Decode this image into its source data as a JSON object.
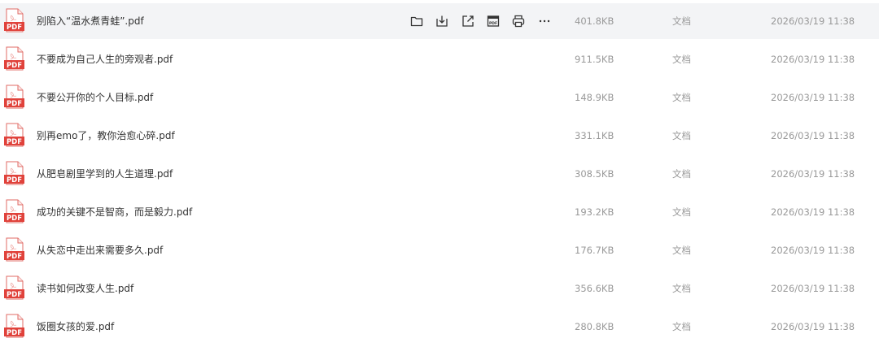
{
  "files": [
    {
      "name": "别陷入“温水煮青蛙”.pdf",
      "size": "401.8KB",
      "type": "文档",
      "date": "2026/03/19 11:38",
      "icon": "pdf-file-icon"
    },
    {
      "name": "不要成为自己人生的旁观者.pdf",
      "size": "911.5KB",
      "type": "文档",
      "date": "2026/03/19 11:38",
      "icon": "pdf-file-icon"
    },
    {
      "name": "不要公开你的个人目标.pdf",
      "size": "148.9KB",
      "type": "文档",
      "date": "2026/03/19 11:38",
      "icon": "pdf-file-icon"
    },
    {
      "name": "别再emo了，教你治愈心碎.pdf",
      "size": "331.1KB",
      "type": "文档",
      "date": "2026/03/19 11:38",
      "icon": "pdf-file-icon"
    },
    {
      "name": "从肥皂剧里学到的人生道理.pdf",
      "size": "308.5KB",
      "type": "文档",
      "date": "2026/03/19 11:38",
      "icon": "pdf-file-icon"
    },
    {
      "name": "成功的关键不是智商，而是毅力.pdf",
      "size": "193.2KB",
      "type": "文档",
      "date": "2026/03/19 11:38",
      "icon": "pdf-file-icon"
    },
    {
      "name": "从失恋中走出来需要多久.pdf",
      "size": "176.7KB",
      "type": "文档",
      "date": "2026/03/19 11:38",
      "icon": "pdf-file-icon"
    },
    {
      "name": "读书如何改变人生.pdf",
      "size": "356.6KB",
      "type": "文档",
      "date": "2026/03/19 11:38",
      "icon": "pdf-file-icon"
    },
    {
      "name": "饭圈女孩的爱.pdf",
      "size": "280.8KB",
      "type": "文档",
      "date": "2026/03/19 11:38",
      "icon": "pdf-file-icon"
    }
  ],
  "pdf_icon_label": "PDF",
  "row_actions": [
    "folder-icon",
    "download-icon",
    "share-icon",
    "convert-pdf-icon",
    "print-icon",
    "more-icon"
  ],
  "colors": {
    "pdf_red": "#e0423b",
    "hover_row": "#f3f4f6",
    "icon_gray": "#333333",
    "meta_text": "#999999"
  }
}
